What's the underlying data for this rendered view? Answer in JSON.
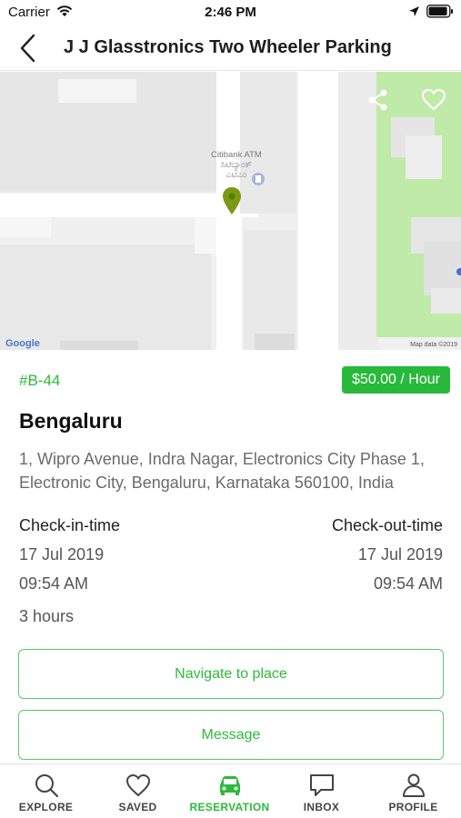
{
  "status_bar": {
    "carrier": "Carrier",
    "time": "2:46 PM"
  },
  "nav": {
    "title": "J J Glasstronics Two Wheeler Parking"
  },
  "map": {
    "poi_label_line1": "Citibank ATM",
    "poi_label_line2": "ಸಿಟಿಬ್ಯಾಂಕ್",
    "poi_label_line3": "ಎಟಿಎಂ",
    "attribution_logo": "Google",
    "map_data": "Map data ©2019",
    "accent_green": "#bfeaa7",
    "pin_color": "#7a9a12"
  },
  "details": {
    "spot_id": "#B-44",
    "price": "$50.00 / Hour",
    "city": "Bengaluru",
    "address": "1, Wipro Avenue, Indra Nagar, Electronics City Phase 1, Electronic City, Bengaluru, Karnataka 560100, India",
    "checkin_label": "Check-in-time",
    "checkout_label": "Check-out-time",
    "checkin_date": "17 Jul 2019",
    "checkout_date": "17 Jul 2019",
    "checkin_time": "09:54 AM",
    "checkout_time": "09:54 AM",
    "duration": "3 hours"
  },
  "actions": {
    "navigate_label": "Navigate to place",
    "message_label": "Message"
  },
  "tabs": [
    {
      "label": "EXPLORE",
      "icon": "search-icon"
    },
    {
      "label": "SAVED",
      "icon": "heart-icon"
    },
    {
      "label": "RESERVATION",
      "icon": "car-icon",
      "active": true
    },
    {
      "label": "INBOX",
      "icon": "chat-icon"
    },
    {
      "label": "PROFILE",
      "icon": "person-icon"
    }
  ],
  "colors": {
    "brand_green": "#2dbb3a",
    "badge_green": "#28b93a"
  }
}
